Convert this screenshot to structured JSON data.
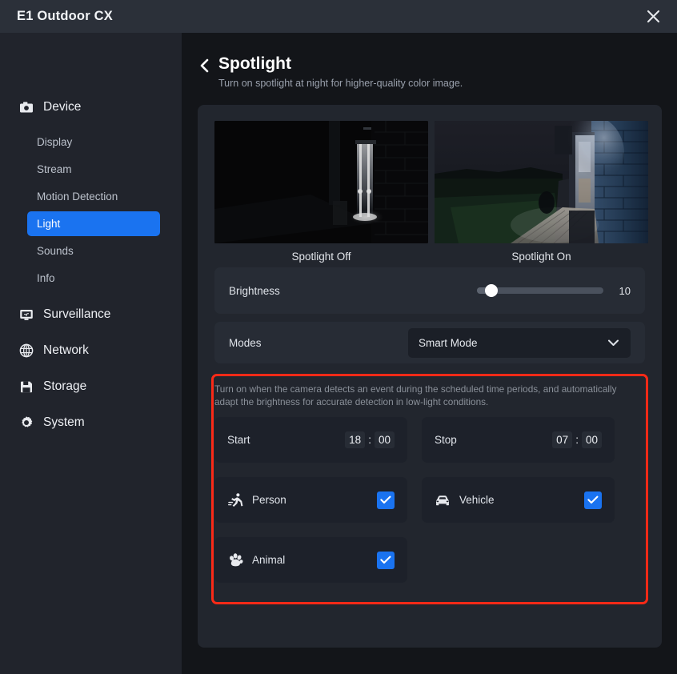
{
  "titlebar": {
    "app_title": "E1 Outdoor CX",
    "close_icon": "close-icon"
  },
  "sidebar": {
    "sections": [
      {
        "label": "Device",
        "icon": "camera-icon",
        "items": [
          {
            "label": "Display",
            "active": false
          },
          {
            "label": "Stream",
            "active": false
          },
          {
            "label": "Motion Detection",
            "active": false
          },
          {
            "label": "Light",
            "active": true
          },
          {
            "label": "Sounds",
            "active": false
          },
          {
            "label": "Info",
            "active": false
          }
        ]
      },
      {
        "label": "Surveillance",
        "icon": "monitor-icon",
        "items": []
      },
      {
        "label": "Network",
        "icon": "globe-icon",
        "items": []
      },
      {
        "label": "Storage",
        "icon": "floppy-disk-icon",
        "items": []
      },
      {
        "label": "System",
        "icon": "gear-icon",
        "items": []
      }
    ]
  },
  "page": {
    "back_icon": "chevron-left-icon",
    "title": "Spotlight",
    "subtitle": "Turn on spotlight at night for higher-quality color image."
  },
  "previews": [
    {
      "label": "Spotlight Off",
      "state": "off"
    },
    {
      "label": "Spotlight On",
      "state": "on"
    }
  ],
  "brightness": {
    "label": "Brightness",
    "value": "10",
    "percent": 10
  },
  "modes": {
    "label": "Modes",
    "selected": "Smart Mode",
    "caret_icon": "chevron-down-icon"
  },
  "smart_mode": {
    "hint": "Turn on when the camera detects an event during the scheduled time periods, and automatically adapt the brightness for accurate detection in low-light conditions.",
    "schedule": [
      {
        "label": "Start",
        "hour": "18",
        "minute": "00"
      },
      {
        "label": "Stop",
        "hour": "07",
        "minute": "00"
      }
    ],
    "detections": [
      {
        "label": "Person",
        "icon": "running-person-icon",
        "checked": true
      },
      {
        "label": "Vehicle",
        "icon": "car-icon",
        "checked": true
      },
      {
        "label": "Animal",
        "icon": "paw-print-icon",
        "checked": true
      }
    ],
    "check_icon": "checkmark-icon",
    "highlight_color": "#fa2a17"
  },
  "colors": {
    "accent": "#1a73f0",
    "titlebar": "#2b3039",
    "sidebar": "#21242c",
    "card": "#22262e",
    "panel": "#272c35",
    "tile": "#1d212a"
  }
}
